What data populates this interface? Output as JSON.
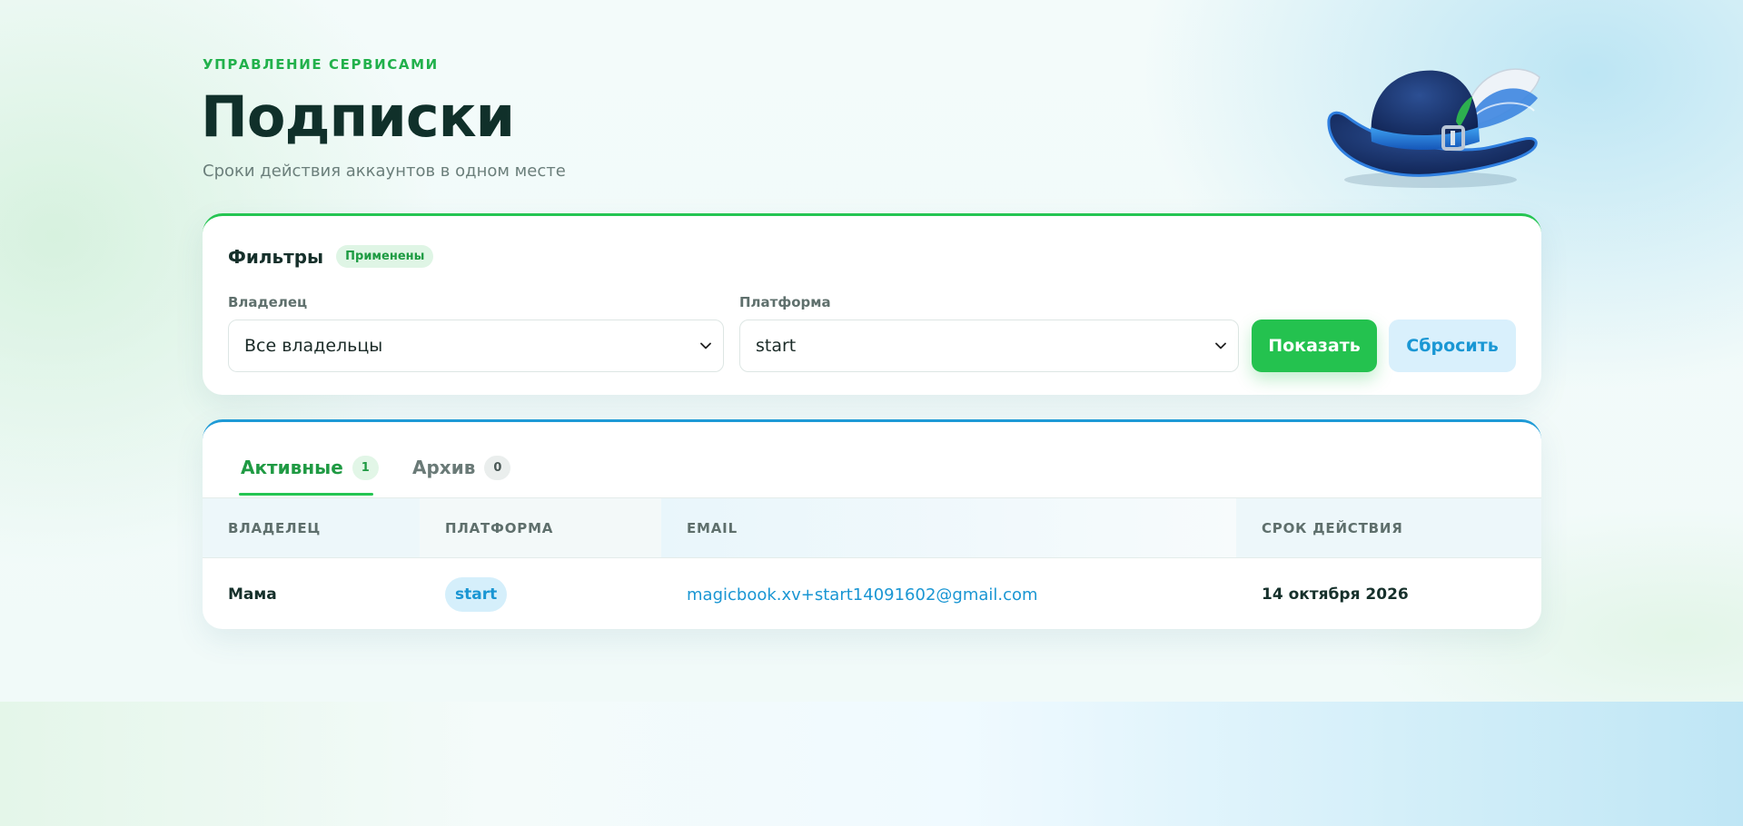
{
  "header": {
    "eyebrow": "УПРАВЛЕНИЕ СЕРВИСАМИ",
    "title": "Подписки",
    "subtitle": "Сроки действия аккаунтов в одном месте",
    "logo_icon": "musketeer-hat-icon"
  },
  "filters": {
    "title": "Фильтры",
    "status_badge": "Применены",
    "owner": {
      "label": "Владелец",
      "selected": "Все владельцы"
    },
    "platform": {
      "label": "Платформа",
      "selected": "start"
    },
    "show_button": "Показать",
    "reset_button": "Сбросить"
  },
  "tabs": [
    {
      "label": "Активные",
      "count": "1",
      "active": true
    },
    {
      "label": "Архив",
      "count": "0",
      "active": false
    }
  ],
  "table": {
    "columns": [
      "ВЛАДЕЛЕЦ",
      "ПЛАТФОРМА",
      "EMAIL",
      "СРОК ДЕЙСТВИЯ"
    ],
    "rows": [
      {
        "owner": "Мама",
        "platform": "start",
        "email": "magicbook.xv+start14091602@gmail.com",
        "expires": "14 октября 2026"
      }
    ]
  },
  "colors": {
    "accent_green": "#24c24f",
    "accent_blue": "#1a97d4",
    "text_dark": "#16302b"
  }
}
